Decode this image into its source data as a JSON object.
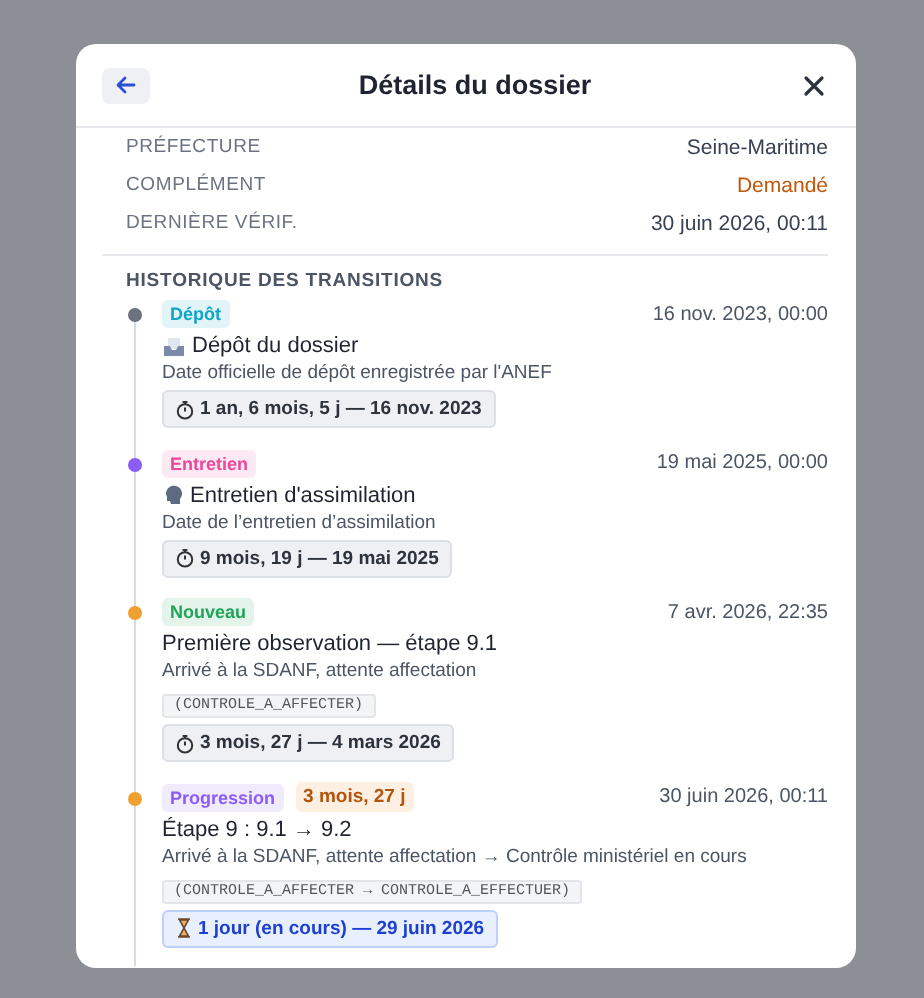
{
  "dialog": {
    "title": "Détails du dossier"
  },
  "fields": [
    {
      "label": "PRÉFECTURE",
      "value": "Seine-Maritime",
      "kind": "plain"
    },
    {
      "label": "COMPLÉMENT",
      "value": "Demandé",
      "kind": "warning"
    },
    {
      "label": "DERNIÈRE VÉRIF.",
      "value": "30 juin 2026, 00:11",
      "kind": "plain"
    }
  ],
  "history": {
    "title": "HISTORIQUE DES TRANSITIONS",
    "items": [
      {
        "kind": "depot",
        "badge": "Dépôt",
        "date": "16 nov. 2023, 00:00",
        "title": "Dépôt du dossier",
        "description": "Date officielle de dépôt enregistrée par l'ANEF",
        "duration": "1 an, 6 mois, 5 j — 16 nov. 2023",
        "current": false
      },
      {
        "kind": "entretien",
        "badge": "Entretien",
        "date": "19 mai 2025, 00:00",
        "title": "Entretien d'assimilation",
        "description": "Date de l’entretien d’assimilation",
        "duration": "9 mois, 19 j — 19 mai 2025",
        "current": false
      },
      {
        "kind": "nouveau",
        "badge": "Nouveau",
        "date": "7 avr. 2026, 22:35",
        "title": "Première observation — étape 9.1",
        "description": "Arrivé à la SDANF, attente affectation",
        "code": "(CONTROLE_A_AFFECTER)",
        "duration": "3 mois, 27 j — 4 mars 2026",
        "current": false
      },
      {
        "kind": "progression",
        "badge": "Progression",
        "extra_badge": "3 mois, 27 j",
        "date": "30 juin 2026, 00:11",
        "title": "Étape 9 : 9.1 → 9.2",
        "description": "Arrivé à la SDANF, attente affectation → Contrôle ministériel en cours",
        "code": "(CONTROLE_A_AFFECTER → CONTROLE_A_EFFECTUER)",
        "duration": "1 jour (en cours) — 29 juin 2026",
        "current": true
      }
    ]
  }
}
